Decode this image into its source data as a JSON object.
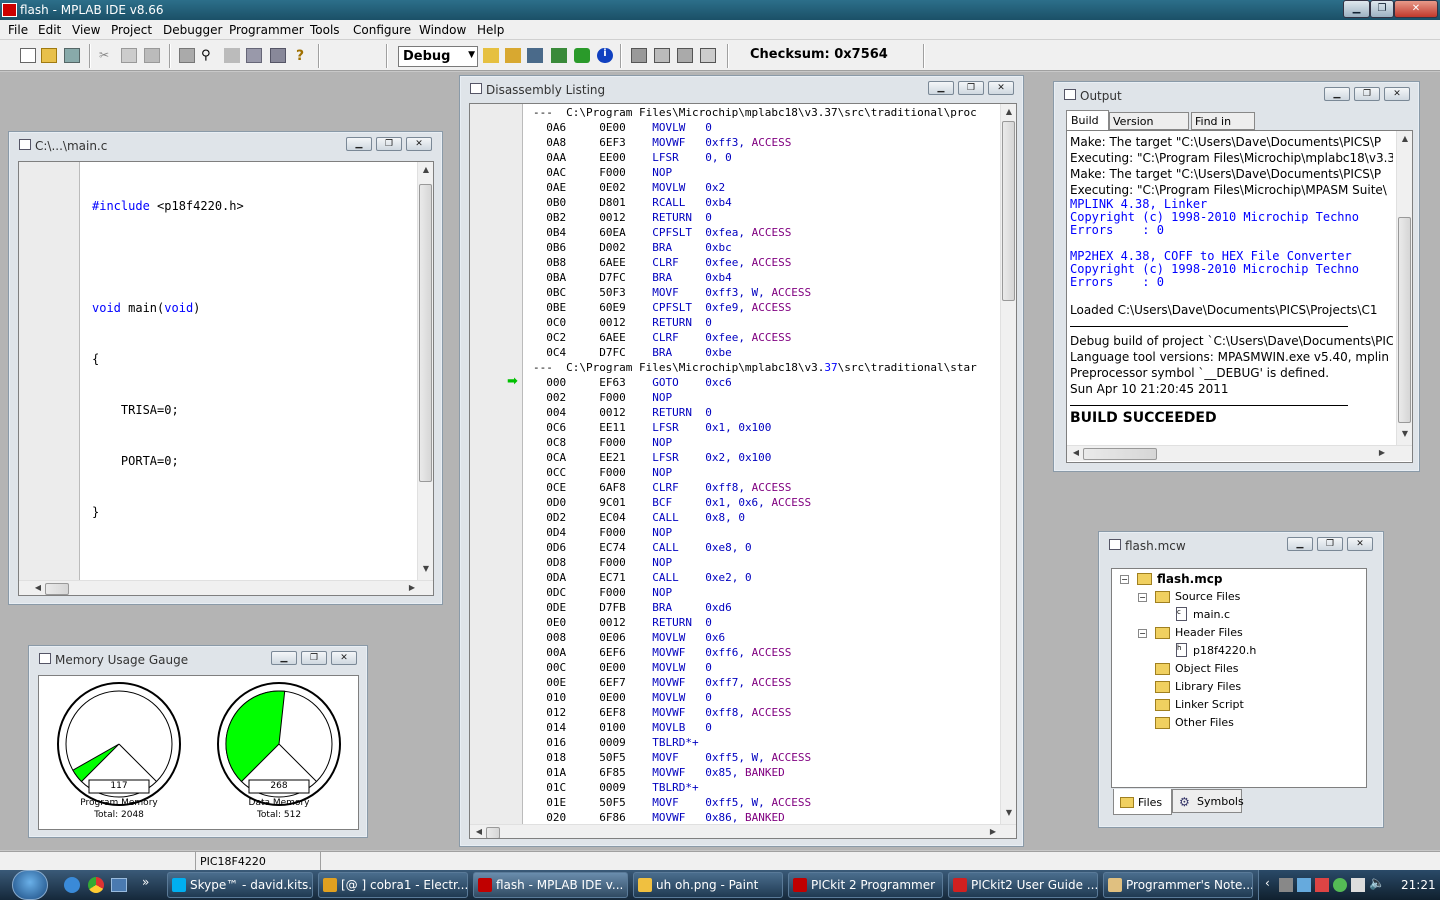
{
  "app": {
    "title": "flash - MPLAB IDE v8.66"
  },
  "menu": [
    "File",
    "Edit",
    "View",
    "Project",
    "Debugger",
    "Programmer",
    "Tools",
    "Configure",
    "Window",
    "Help"
  ],
  "toolbar": {
    "config_select": "Debug",
    "checksum": "Checksum:  0x7564"
  },
  "editor": {
    "title": "C:\\...\\main.c",
    "lines": [
      {
        "a": "#include",
        "b": " <p18f4220.h>"
      },
      {
        "a": "",
        "b": ""
      },
      {
        "a": "void",
        "b": " main(",
        "c": "void",
        ")": ")"
      },
      {
        "a": "",
        "b": "{"
      },
      {
        "a": "",
        "b": "    TRISA=0;"
      },
      {
        "a": "",
        "b": "    PORTA=0;"
      },
      {
        "a": "",
        "b": "}"
      }
    ]
  },
  "disasm": {
    "title": "Disassembly Listing",
    "header1": "---  C:\\Program Files\\Microchip\\mplabc18\\v3.37\\src\\traditional\\proc",
    "header2_a": "---  C:\\Program Files\\Microchip\\mplabc18\\v3.",
    "header2_b": "37",
    "header2_c": "\\src\\traditional\\star",
    "rows1": [
      [
        "0A6",
        "0E00",
        "MOVLW",
        "0",
        ""
      ],
      [
        "0A8",
        "6EF3",
        "MOVWF",
        "0xff3,",
        "ACCESS"
      ],
      [
        "0AA",
        "EE00",
        "LFSR",
        "0, 0",
        ""
      ],
      [
        "0AC",
        "F000",
        "NOP",
        "",
        ""
      ],
      [
        "0AE",
        "0E02",
        "MOVLW",
        "0x2",
        ""
      ],
      [
        "0B0",
        "D801",
        "RCALL",
        "0xb4",
        ""
      ],
      [
        "0B2",
        "0012",
        "RETURN",
        "0",
        ""
      ],
      [
        "0B4",
        "60EA",
        "CPFSLT",
        "0xfea,",
        "ACCESS"
      ],
      [
        "0B6",
        "D002",
        "BRA",
        "0xbc",
        ""
      ],
      [
        "0B8",
        "6AEE",
        "CLRF",
        "0xfee,",
        "ACCESS"
      ],
      [
        "0BA",
        "D7FC",
        "BRA",
        "0xb4",
        ""
      ],
      [
        "0BC",
        "50F3",
        "MOVF",
        "0xff3, W,",
        "ACCESS"
      ],
      [
        "0BE",
        "60E9",
        "CPFSLT",
        "0xfe9,",
        "ACCESS"
      ],
      [
        "0C0",
        "0012",
        "RETURN",
        "0",
        ""
      ],
      [
        "0C2",
        "6AEE",
        "CLRF",
        "0xfee,",
        "ACCESS"
      ],
      [
        "0C4",
        "D7FC",
        "BRA",
        "0xbe",
        ""
      ]
    ],
    "rows2": [
      [
        "000",
        "EF63",
        "GOTO",
        "0xc6",
        ""
      ],
      [
        "002",
        "F000",
        "NOP",
        "",
        ""
      ],
      [
        "004",
        "0012",
        "RETURN",
        "0",
        ""
      ],
      [
        "0C6",
        "EE11",
        "LFSR",
        "0x1, 0x100",
        ""
      ],
      [
        "0C8",
        "F000",
        "NOP",
        "",
        ""
      ],
      [
        "0CA",
        "EE21",
        "LFSR",
        "0x2, 0x100",
        ""
      ],
      [
        "0CC",
        "F000",
        "NOP",
        "",
        ""
      ],
      [
        "0CE",
        "6AF8",
        "CLRF",
        "0xff8,",
        "ACCESS"
      ],
      [
        "0D0",
        "9C01",
        "BCF",
        "0x1, 0x6,",
        "ACCESS"
      ],
      [
        "0D2",
        "EC04",
        "CALL",
        "0x8, 0",
        ""
      ],
      [
        "0D4",
        "F000",
        "NOP",
        "",
        ""
      ],
      [
        "0D6",
        "EC74",
        "CALL",
        "0xe8, 0",
        ""
      ],
      [
        "0D8",
        "F000",
        "NOP",
        "",
        ""
      ],
      [
        "0DA",
        "EC71",
        "CALL",
        "0xe2, 0",
        ""
      ],
      [
        "0DC",
        "F000",
        "NOP",
        "",
        ""
      ],
      [
        "0DE",
        "D7FB",
        "BRA",
        "0xd6",
        ""
      ],
      [
        "0E0",
        "0012",
        "RETURN",
        "0",
        ""
      ],
      [
        "008",
        "0E06",
        "MOVLW",
        "0x6",
        ""
      ],
      [
        "00A",
        "6EF6",
        "MOVWF",
        "0xff6,",
        "ACCESS"
      ],
      [
        "00C",
        "0E00",
        "MOVLW",
        "0",
        ""
      ],
      [
        "00E",
        "6EF7",
        "MOVWF",
        "0xff7,",
        "ACCESS"
      ],
      [
        "010",
        "0E00",
        "MOVLW",
        "0",
        ""
      ],
      [
        "012",
        "6EF8",
        "MOVWF",
        "0xff8,",
        "ACCESS"
      ],
      [
        "014",
        "0100",
        "MOVLB",
        "0",
        ""
      ],
      [
        "016",
        "0009",
        "TBLRD*+",
        "",
        ""
      ],
      [
        "018",
        "50F5",
        "MOVF",
        "0xff5, W,",
        "ACCESS"
      ],
      [
        "01A",
        "6F85",
        "MOVWF",
        "0x85,",
        "BANKED"
      ],
      [
        "01C",
        "0009",
        "TBLRD*+",
        "",
        ""
      ],
      [
        "01E",
        "50F5",
        "MOVF",
        "0xff5, W,",
        "ACCESS"
      ],
      [
        "020",
        "6F86",
        "MOVWF",
        "0x86,",
        "BANKED"
      ]
    ]
  },
  "output": {
    "title": "Output",
    "tabs": [
      "Build",
      "Version Control",
      "Find in Files"
    ],
    "lines": [
      {
        "t": "Make: The target \"C:\\Users\\Dave\\Documents\\PICS\\P",
        "s": "n"
      },
      {
        "t": "Executing: \"C:\\Program Files\\Microchip\\mplabc18\\v3.3",
        "s": "n"
      },
      {
        "t": "Make: The target \"C:\\Users\\Dave\\Documents\\PICS\\P",
        "s": "n"
      },
      {
        "t": "Executing: \"C:\\Program Files\\Microchip\\MPASM Suite\\",
        "s": "n"
      },
      {
        "t": "MPLINK 4.38, Linker",
        "s": "m"
      },
      {
        "t": "Copyright (c) 1998-2010 Microchip Techno",
        "s": "m"
      },
      {
        "t": "Errors    : 0",
        "s": "m"
      },
      {
        "t": "",
        "s": "m"
      },
      {
        "t": "MP2HEX 4.38, COFF to HEX File Converter",
        "s": "m"
      },
      {
        "t": "Copyright (c) 1998-2010 Microchip Techno",
        "s": "m"
      },
      {
        "t": "Errors    : 0",
        "s": "m"
      },
      {
        "t": "",
        "s": "m"
      },
      {
        "t": "Loaded C:\\Users\\Dave\\Documents\\PICS\\Projects\\C1",
        "s": "n"
      }
    ],
    "lines2": [
      "Debug build of project `C:\\Users\\Dave\\Documents\\PIC",
      "Language tool versions: MPASMWIN.exe v5.40, mplin",
      "Preprocessor symbol `__DEBUG' is defined.",
      "Sun Apr 10 21:20:45 2011"
    ],
    "result": "BUILD SUCCEEDED"
  },
  "project": {
    "title": "flash.mcw",
    "root": "flash.mcp",
    "tree": [
      {
        "label": "Source Files",
        "children": [
          "main.c"
        ]
      },
      {
        "label": "Header Files",
        "children": [
          "p18f4220.h"
        ]
      },
      {
        "label": "Object Files",
        "children": []
      },
      {
        "label": "Library Files",
        "children": []
      },
      {
        "label": "Linker Script",
        "children": []
      },
      {
        "label": "Other Files",
        "children": []
      }
    ],
    "tabs": [
      "Files",
      "Symbols"
    ]
  },
  "gauge": {
    "title": "Memory Usage Gauge",
    "program": {
      "used": "117",
      "label": "Program Memory",
      "total": "Total: 2048",
      "fraction": 0.057
    },
    "data": {
      "used": "268",
      "label": "Data Memory",
      "total": "Total: 512",
      "fraction": 0.523
    },
    "fill_color": "#00ff00"
  },
  "status": {
    "device": "PIC18F4220"
  },
  "taskbar": {
    "items": [
      {
        "label": "Skype™ - david.kits...",
        "color": "#00aff0"
      },
      {
        "label": "[@ ] cobra1 - Electr...",
        "color": "#e0a020"
      },
      {
        "label": "flash - MPLAB IDE v...",
        "color": "#c00000"
      },
      {
        "label": "uh oh.png - Paint",
        "color": "#f0c040"
      },
      {
        "label": "PICkit 2 Programmer",
        "color": "#c00000"
      },
      {
        "label": "PICkit2 User Guide ...",
        "color": "#d02020"
      },
      {
        "label": "Programmer's Note...",
        "color": "#e0c080"
      }
    ],
    "clock": "21:21"
  }
}
